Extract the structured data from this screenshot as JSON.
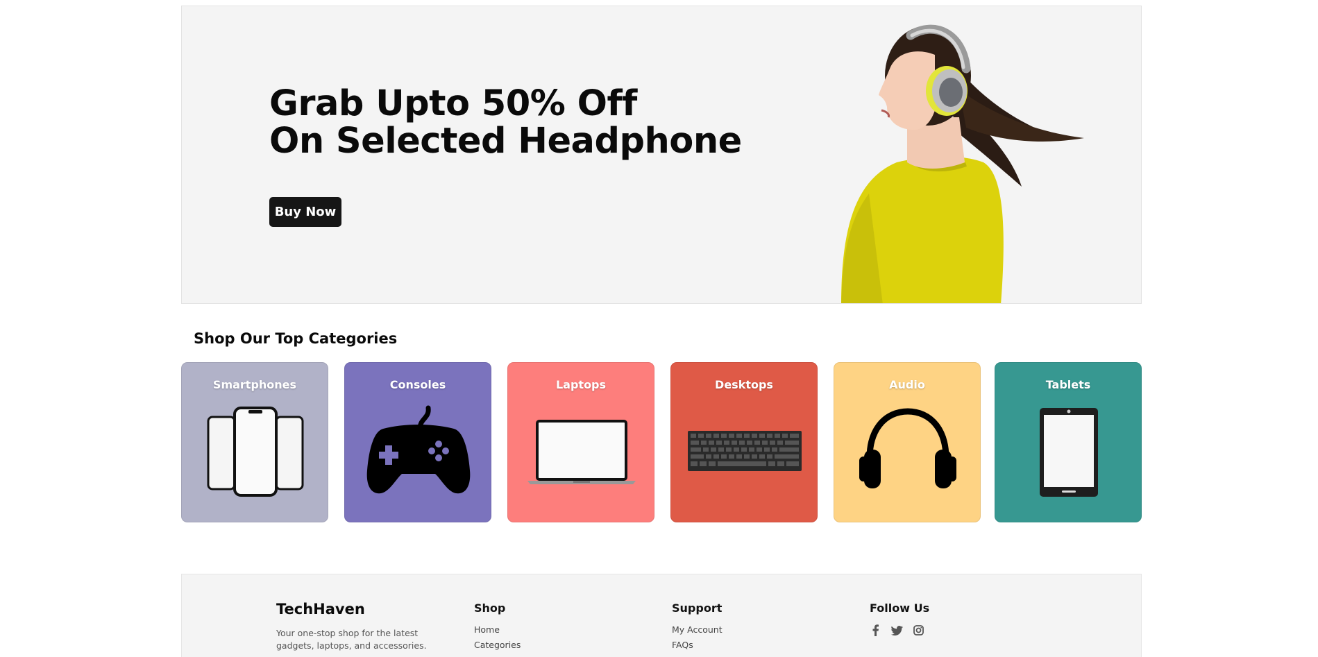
{
  "hero": {
    "title_line1": "Grab Upto 50% Off",
    "title_line2": "On Selected Headphone",
    "button_label": "Buy Now",
    "background": "#f4f4f4"
  },
  "categories": {
    "title": "Shop Our Top Categories",
    "items": [
      {
        "label": "Smartphones",
        "color": "#b1b2c8",
        "icon": "smartphones-icon"
      },
      {
        "label": "Consoles",
        "color": "#7b73bd",
        "icon": "gamepad-icon"
      },
      {
        "label": "Laptops",
        "color": "#fd7e7c",
        "icon": "laptop-icon"
      },
      {
        "label": "Desktops",
        "color": "#df5a47",
        "icon": "keyboard-icon"
      },
      {
        "label": "Audio",
        "color": "#fed384",
        "icon": "headphones-icon"
      },
      {
        "label": "Tablets",
        "color": "#379891",
        "icon": "tablet-icon"
      }
    ]
  },
  "footer": {
    "brand": "TechHaven",
    "tagline": "Your one-stop shop for the latest gadgets, laptops, and accessories.",
    "shop": {
      "title": "Shop",
      "links": [
        "Home",
        "Categories"
      ]
    },
    "support": {
      "title": "Support",
      "links": [
        "My Account",
        "FAQs"
      ]
    },
    "follow": {
      "title": "Follow Us",
      "icons": [
        "facebook-icon",
        "twitter-icon",
        "instagram-icon"
      ]
    }
  }
}
